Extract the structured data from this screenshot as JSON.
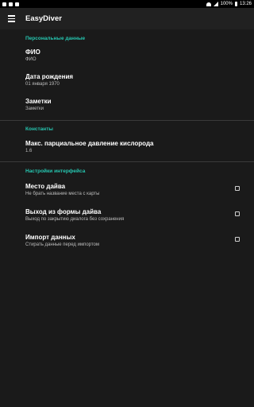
{
  "status_bar": {
    "battery": "100%",
    "time": "13:26"
  },
  "app_bar": {
    "title": "EasyDiver",
    "menu_icon": "hamburger-menu-icon"
  },
  "sections": {
    "personal": {
      "header": "Персональные данные",
      "fio": {
        "title": "ФИО",
        "summary": "ФИО"
      },
      "birth": {
        "title": "Дата рождения",
        "summary": "01 января 1970"
      },
      "notes": {
        "title": "Заметки",
        "summary": "Заметки"
      }
    },
    "constants": {
      "header": "Константы",
      "oxygen": {
        "title": "Макс. парциальное давление кислорода",
        "summary": "1.6"
      }
    },
    "interface": {
      "header": "Настройки интерфейса",
      "dive_place": {
        "title": "Место дайва",
        "summary": "Не брать название места с карты",
        "checked": false
      },
      "exit_form": {
        "title": "Выход из формы дайва",
        "summary": "Выход по закрытию диалога без сохранения",
        "checked": false
      },
      "import": {
        "title": "Импорт данных",
        "summary": "Стирать данные перед импортом",
        "checked": false
      }
    }
  },
  "colors": {
    "accent": "#26c6b0",
    "background": "#1a1a1a",
    "app_bar": "#212121"
  }
}
